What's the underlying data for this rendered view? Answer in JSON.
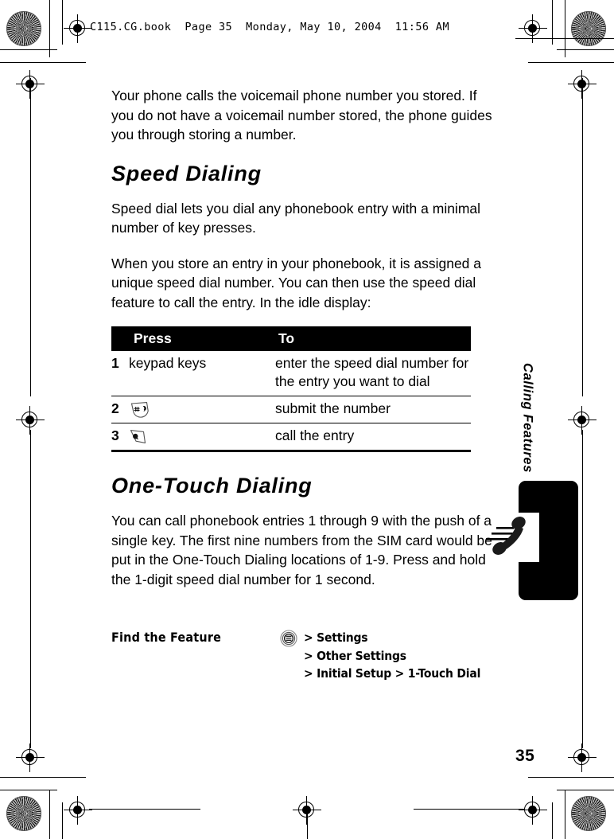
{
  "header": {
    "slug": "C115.CG.book  Page 35  Monday, May 10, 2004  11:56 AM"
  },
  "content": {
    "intro_paragraph": "Your phone calls the voicemail phone number you stored. If you do not have a voicemail number stored, the phone guides you through storing a number.",
    "speed_dialing_heading": "Speed Dialing",
    "speed_dialing_p1": "Speed dial lets you dial any phonebook entry with a minimal number of key presses.",
    "speed_dialing_p2": "When you store an entry in your phonebook, it is assigned a unique speed dial number. You can then use the speed dial feature to call the entry. In the idle display:",
    "one_touch_heading": "One-Touch Dialing",
    "one_touch_p1": "You can call phonebook entries 1 through 9 with the push of a single key. The first nine numbers from the SIM card would be put in the One-Touch Dialing locations of 1-9. Press and hold the 1-digit speed dial number for 1 second."
  },
  "step_table": {
    "headers": [
      "",
      "Press",
      "To"
    ],
    "rows": [
      {
        "num": "1",
        "press_text": "keypad keys",
        "press_icon": "",
        "to": "enter the speed dial number for the entry you want to dial"
      },
      {
        "num": "2",
        "press_text": "",
        "press_icon": "pound-key-icon",
        "to": "submit the number"
      },
      {
        "num": "3",
        "press_text": "",
        "press_icon": "send-key-icon",
        "to": "call the entry"
      }
    ]
  },
  "find_feature": {
    "label": "Find the Feature",
    "menu_icon": "menu-circle-icon",
    "path_rows": [
      {
        "gt": ">",
        "item": "Settings"
      },
      {
        "gt": ">",
        "item": "Other Settings"
      },
      {
        "gt": ">",
        "item": "Initial Setup > 1-Touch Dial"
      }
    ]
  },
  "side_tab": {
    "label": "Calling Features"
  },
  "illustration": {
    "name": "phone-handset-illustration"
  },
  "footer": {
    "page_number": "35"
  },
  "colors": {
    "ink": "#000000",
    "paper": "#ffffff",
    "table_header_bg": "#000000",
    "table_header_fg": "#ffffff"
  }
}
